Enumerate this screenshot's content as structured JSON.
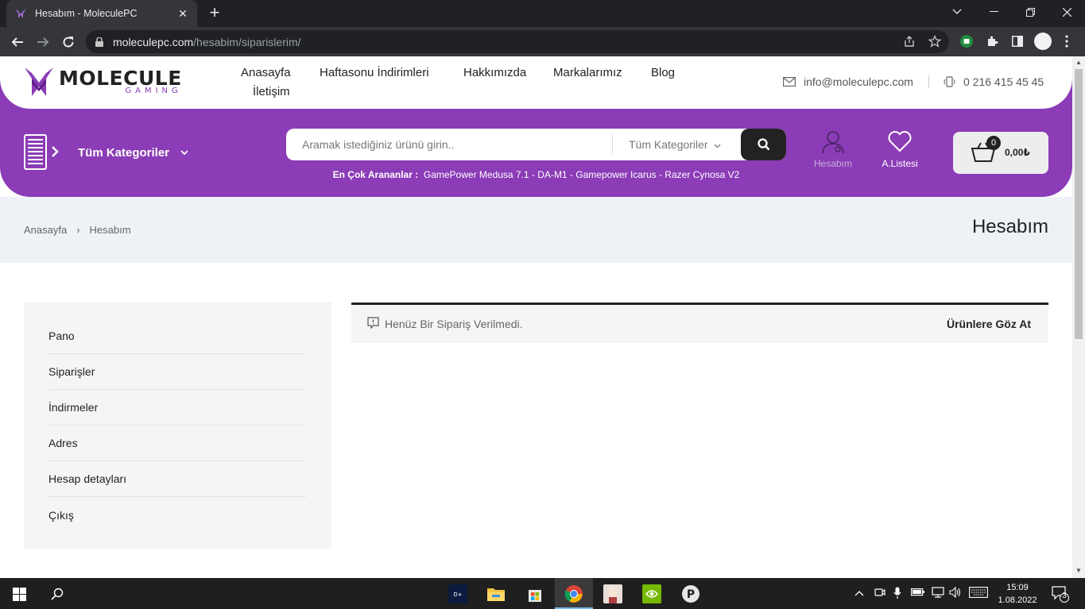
{
  "browser": {
    "tab_title": "Hesabım - MoleculePC",
    "url_host": "moleculepc.com",
    "url_path": "/hesabim/siparislerim/"
  },
  "header": {
    "logo_main": "MOLECULE",
    "logo_sub": "GAMING",
    "nav": [
      "Anasayfa",
      "Haftasonu İndirimleri",
      "Hakkımızda",
      "Markalarımız",
      "Blog",
      "İletişim"
    ],
    "email": "info@moleculepc.com",
    "phone": "0 216 415 45 45",
    "categories_label": "Tüm Kategoriler",
    "search_placeholder": "Aramak istediğiniz ürünü girin..",
    "search_category": "Tüm Kategoriler",
    "popular_label": "En Çok Arananlar :",
    "popular_terms": "GamePower Medusa 7.1 - DA-M1 - Gamepower Icarus - Razer Cynosa V2",
    "account_label": "Hesabım",
    "wishlist_label": "A.Listesi",
    "cart_count": "0",
    "cart_total": "0,00₺"
  },
  "breadcrumb": {
    "home": "Anasayfa",
    "separator": "›",
    "current": "Hesabım",
    "title": "Hesabım"
  },
  "account_menu": [
    "Pano",
    "Siparişler",
    "İndirmeler",
    "Adres",
    "Hesap detayları",
    "Çıkış"
  ],
  "notice": {
    "message": "Henüz Bir Sipariş Verilmedi.",
    "action": "Ürünlere Göz At"
  },
  "taskbar": {
    "time": "15:09",
    "date": "1.08.2022",
    "notification_count": "3"
  },
  "colors": {
    "brand_purple": "#8b3cb6",
    "dark": "#222222"
  }
}
